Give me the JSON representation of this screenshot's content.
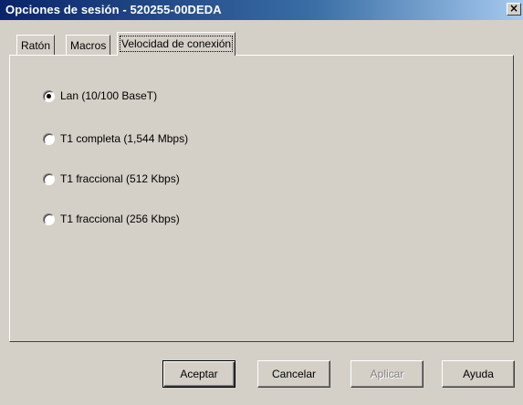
{
  "window": {
    "title": "Opciones de sesión - 520255-00DEDA",
    "close_glyph": "×"
  },
  "tabs": [
    {
      "label": "Ratón",
      "active": false
    },
    {
      "label": "Macros",
      "active": false
    },
    {
      "label": "Velocidad de conexión",
      "active": true
    }
  ],
  "options": [
    {
      "label": "Lan (10/100 BaseT)",
      "checked": true
    },
    {
      "label": "T1 completa (1,544 Mbps)",
      "checked": false
    },
    {
      "label": "T1 fraccional (512 Kbps)",
      "checked": false
    },
    {
      "label": "T1 fraccional (256 Kbps)",
      "checked": false
    }
  ],
  "buttons": {
    "accept": "Aceptar",
    "cancel": "Cancelar",
    "apply": "Aplicar",
    "help": "Ayuda"
  },
  "colors": {
    "titlebar": "#0a246a",
    "face": "#d4d0c8"
  }
}
